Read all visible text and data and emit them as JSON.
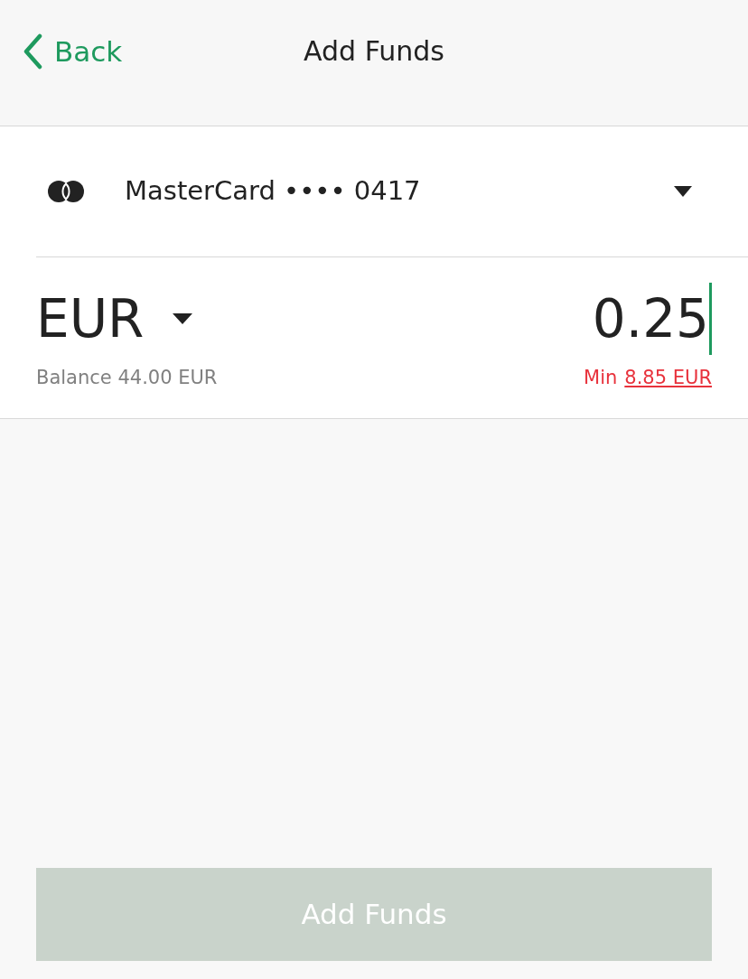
{
  "header": {
    "back": "Back",
    "title": "Add Funds"
  },
  "card": {
    "label": "MasterCard •••• 0417"
  },
  "amount": {
    "currency": "EUR",
    "value": "0.25",
    "balance": "Balance 44.00 EUR",
    "min_label": "Min",
    "min_value": "8.85 EUR"
  },
  "button": {
    "label": "Add Funds",
    "disabled": true
  }
}
